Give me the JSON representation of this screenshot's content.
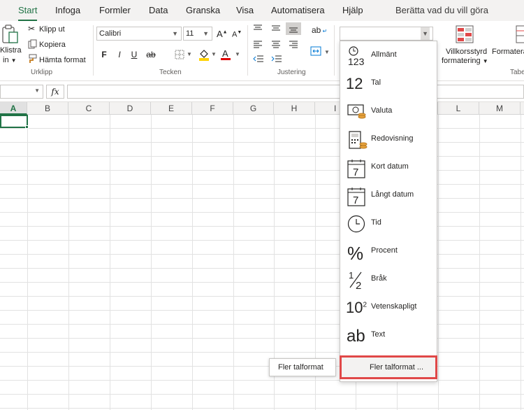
{
  "tabs": [
    "Start",
    "Infoga",
    "Formler",
    "Data",
    "Granska",
    "Visa",
    "Automatisera",
    "Hjälp"
  ],
  "active_tab": "Start",
  "tell_me": "Berätta vad du vill göra",
  "clipboard": {
    "paste_line1": "Klistra",
    "paste_line2": "in",
    "cut": "Klipp ut",
    "copy": "Kopiera",
    "format_painter": "Hämta format",
    "group": "Urklipp"
  },
  "font": {
    "name": "Calibri",
    "size": "11",
    "grow": "A",
    "shrink": "A",
    "bold": "F",
    "italic": "I",
    "underline": "U",
    "strike": "ab",
    "font_color_letter": "A",
    "group": "Tecken"
  },
  "alignment": {
    "group": "Justering",
    "wrap": "ab"
  },
  "number": {
    "value": ""
  },
  "conditional": {
    "line1": "Villkorsstyrd",
    "line2": "formatering"
  },
  "format_table": {
    "line1": "Formatera"
  },
  "cut_group": "Tabe",
  "formula_bar": {
    "fx": "fx",
    "name_box": ""
  },
  "columns": [
    "A",
    "B",
    "C",
    "D",
    "E",
    "F",
    "G",
    "H",
    "I",
    "L",
    "M"
  ],
  "selected_column": "A",
  "number_formats": [
    {
      "label": "Allmänt",
      "icon": "general-icon"
    },
    {
      "label": "Tal",
      "icon": "number-icon",
      "glyph": "12"
    },
    {
      "label": "Valuta",
      "icon": "currency-icon"
    },
    {
      "label": "Redovisning",
      "icon": "accounting-icon"
    },
    {
      "label": "Kort datum",
      "icon": "short-date-icon",
      "glyph": "7"
    },
    {
      "label": "Långt datum",
      "icon": "long-date-icon",
      "glyph": "7"
    },
    {
      "label": "Tid",
      "icon": "clock-icon"
    },
    {
      "label": "Procent",
      "icon": "percent-icon",
      "glyph": "%"
    },
    {
      "label": "Bråk",
      "icon": "fraction-icon"
    },
    {
      "label": "Vetenskapligt",
      "icon": "scientific-icon"
    },
    {
      "label": "Text",
      "icon": "text-icon",
      "glyph": "ab"
    }
  ],
  "general_glyph": "123",
  "fraction": {
    "num": "1",
    "den": "2"
  },
  "scientific": {
    "base": "10",
    "exp": "2"
  },
  "more_formats": "Fler talformat ...",
  "tooltip": "Fler talformat",
  "colors": {
    "accent": "#217346",
    "highlight_border": "#e04848",
    "font_red": "#e00000",
    "highlight_yellow": "#ffd200"
  }
}
